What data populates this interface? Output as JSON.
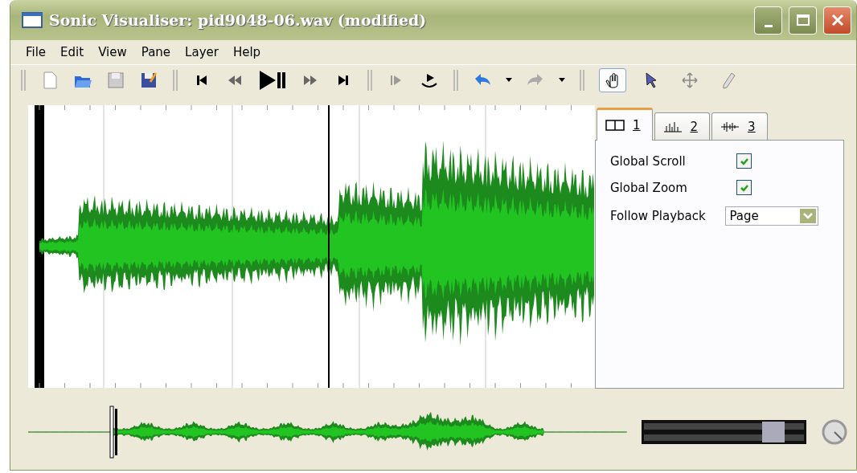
{
  "window": {
    "title": "Sonic Visualiser: pid9048-06.wav (modified)"
  },
  "menu": [
    "File",
    "Edit",
    "View",
    "Pane",
    "Layer",
    "Help"
  ],
  "tools": [
    {
      "selected": true
    },
    {
      "selected": false
    },
    {
      "selected": false
    },
    {
      "selected": false
    }
  ],
  "tabs": [
    {
      "label": "1",
      "selected": true
    },
    {
      "label": "2",
      "selected": false
    },
    {
      "label": "3",
      "selected": false
    }
  ],
  "options": [
    {
      "kind": "checkbox",
      "label": "Global Scroll",
      "checked": true
    },
    {
      "kind": "checkbox",
      "label": "Global Zoom",
      "checked": true
    },
    {
      "kind": "dropdown",
      "label": "Follow Playback",
      "value": "Page"
    }
  ]
}
